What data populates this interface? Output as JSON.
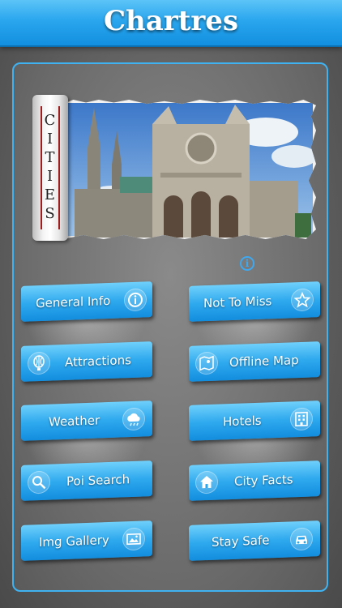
{
  "app": {
    "title": "Chartres"
  },
  "banner": {
    "scroll_label": "CITIES"
  },
  "colors": {
    "accent": "#2aa6ee",
    "panel_border": "#3fb3f2"
  },
  "menu": [
    {
      "label": "General Info",
      "icon": "info-icon"
    },
    {
      "label": "Not To Miss",
      "icon": "star-icon"
    },
    {
      "label": "Attractions",
      "icon": "balloon-icon"
    },
    {
      "label": "Offline Map",
      "icon": "map-icon"
    },
    {
      "label": "Weather",
      "icon": "weather-icon"
    },
    {
      "label": "Hotels",
      "icon": "hotel-icon"
    },
    {
      "label": "Poi Search",
      "icon": "search-icon"
    },
    {
      "label": "City Facts",
      "icon": "home-icon"
    },
    {
      "label": "Img Gallery",
      "icon": "gallery-icon"
    },
    {
      "label": "Stay Safe",
      "icon": "car-icon"
    }
  ]
}
